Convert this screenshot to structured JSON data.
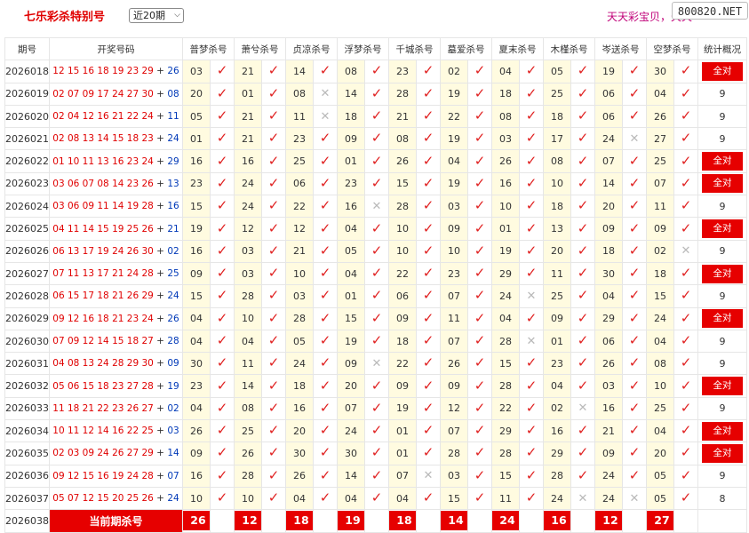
{
  "header": {
    "title": "七乐彩杀特别号",
    "period_select": "近20期",
    "slogan": "天天彩宝贝，天天",
    "watermark": "800820.NET"
  },
  "table": {
    "columns": [
      "期号",
      "开奖号码",
      "普梦杀号",
      "萧兮杀号",
      "贞凉杀号",
      "浮梦杀号",
      "千城杀号",
      "墓爱杀号",
      "夏末杀号",
      "木槿杀号",
      "岑送杀号",
      "空梦杀号",
      "统计概况"
    ],
    "rows": [
      {
        "issue": "2026018",
        "main": "12 15 16 18 19 23 29",
        "special": "26",
        "kills": [
          "03",
          "21",
          "14",
          "08",
          "23",
          "02",
          "04",
          "05",
          "19",
          "30"
        ],
        "marks": [
          "ok",
          "ok",
          "ok",
          "ok",
          "ok",
          "ok",
          "ok",
          "ok",
          "ok",
          "ok"
        ],
        "stat": "全对"
      },
      {
        "issue": "2026019",
        "main": "02 07 09 17 24 27 30",
        "special": "08",
        "kills": [
          "20",
          "01",
          "08",
          "14",
          "28",
          "19",
          "18",
          "25",
          "06",
          "04"
        ],
        "marks": [
          "ok",
          "ok",
          "ng",
          "ok",
          "ok",
          "ok",
          "ok",
          "ok",
          "ok",
          "ok"
        ],
        "stat": "9"
      },
      {
        "issue": "2026020",
        "main": "02 04 12 16 21 22 24",
        "special": "11",
        "kills": [
          "05",
          "21",
          "11",
          "18",
          "21",
          "22",
          "08",
          "18",
          "06",
          "26"
        ],
        "marks": [
          "ok",
          "ok",
          "ng",
          "ok",
          "ok",
          "ok",
          "ok",
          "ok",
          "ok",
          "ok"
        ],
        "stat": "9"
      },
      {
        "issue": "2026021",
        "main": "02 08 13 14 15 18 23",
        "special": "24",
        "kills": [
          "01",
          "21",
          "23",
          "09",
          "08",
          "19",
          "03",
          "17",
          "24",
          "27"
        ],
        "marks": [
          "ok",
          "ok",
          "ok",
          "ok",
          "ok",
          "ok",
          "ok",
          "ok",
          "ng",
          "ok"
        ],
        "stat": "9"
      },
      {
        "issue": "2026022",
        "main": "01 10 11 13 16 23 24",
        "special": "29",
        "kills": [
          "16",
          "16",
          "25",
          "01",
          "26",
          "04",
          "26",
          "08",
          "07",
          "25"
        ],
        "marks": [
          "ok",
          "ok",
          "ok",
          "ok",
          "ok",
          "ok",
          "ok",
          "ok",
          "ok",
          "ok"
        ],
        "stat": "全对"
      },
      {
        "issue": "2026023",
        "main": "03 06 07 08 14 23 26",
        "special": "13",
        "kills": [
          "23",
          "24",
          "06",
          "23",
          "15",
          "19",
          "16",
          "10",
          "14",
          "07"
        ],
        "marks": [
          "ok",
          "ok",
          "ok",
          "ok",
          "ok",
          "ok",
          "ok",
          "ok",
          "ok",
          "ok"
        ],
        "stat": "全对"
      },
      {
        "issue": "2026024",
        "main": "03 06 09 11 14 19 28",
        "special": "16",
        "kills": [
          "15",
          "24",
          "22",
          "16",
          "28",
          "03",
          "10",
          "18",
          "20",
          "11"
        ],
        "marks": [
          "ok",
          "ok",
          "ok",
          "ng",
          "ok",
          "ok",
          "ok",
          "ok",
          "ok",
          "ok"
        ],
        "stat": "9"
      },
      {
        "issue": "2026025",
        "main": "04 11 14 15 19 25 26",
        "special": "21",
        "kills": [
          "19",
          "12",
          "12",
          "04",
          "10",
          "09",
          "01",
          "13",
          "09",
          "09"
        ],
        "marks": [
          "ok",
          "ok",
          "ok",
          "ok",
          "ok",
          "ok",
          "ok",
          "ok",
          "ok",
          "ok"
        ],
        "stat": "全对"
      },
      {
        "issue": "2026026",
        "main": "06 13 17 19 24 26 30",
        "special": "02",
        "kills": [
          "16",
          "03",
          "21",
          "05",
          "10",
          "10",
          "19",
          "20",
          "18",
          "02"
        ],
        "marks": [
          "ok",
          "ok",
          "ok",
          "ok",
          "ok",
          "ok",
          "ok",
          "ok",
          "ok",
          "ng"
        ],
        "stat": "9"
      },
      {
        "issue": "2026027",
        "main": "07 11 13 17 21 24 28",
        "special": "25",
        "kills": [
          "09",
          "03",
          "10",
          "04",
          "22",
          "23",
          "29",
          "11",
          "30",
          "18"
        ],
        "marks": [
          "ok",
          "ok",
          "ok",
          "ok",
          "ok",
          "ok",
          "ok",
          "ok",
          "ok",
          "ok"
        ],
        "stat": "全对"
      },
      {
        "issue": "2026028",
        "main": "06 15 17 18 21 26 29",
        "special": "24",
        "kills": [
          "15",
          "28",
          "03",
          "01",
          "06",
          "07",
          "24",
          "25",
          "04",
          "15"
        ],
        "marks": [
          "ok",
          "ok",
          "ok",
          "ok",
          "ok",
          "ok",
          "ng",
          "ok",
          "ok",
          "ok"
        ],
        "stat": "9"
      },
      {
        "issue": "2026029",
        "main": "09 12 16 18 21 23 24",
        "special": "26",
        "kills": [
          "04",
          "10",
          "28",
          "15",
          "09",
          "11",
          "04",
          "09",
          "29",
          "24"
        ],
        "marks": [
          "ok",
          "ok",
          "ok",
          "ok",
          "ok",
          "ok",
          "ok",
          "ok",
          "ok",
          "ok"
        ],
        "stat": "全对"
      },
      {
        "issue": "2026030",
        "main": "07 09 12 14 15 18 27",
        "special": "28",
        "kills": [
          "04",
          "04",
          "05",
          "19",
          "18",
          "07",
          "28",
          "01",
          "06",
          "04"
        ],
        "marks": [
          "ok",
          "ok",
          "ok",
          "ok",
          "ok",
          "ok",
          "ng",
          "ok",
          "ok",
          "ok"
        ],
        "stat": "9"
      },
      {
        "issue": "2026031",
        "main": "04 08 13 24 28 29 30",
        "special": "09",
        "kills": [
          "30",
          "11",
          "24",
          "09",
          "22",
          "26",
          "15",
          "23",
          "26",
          "08"
        ],
        "marks": [
          "ok",
          "ok",
          "ok",
          "ng",
          "ok",
          "ok",
          "ok",
          "ok",
          "ok",
          "ok"
        ],
        "stat": "9"
      },
      {
        "issue": "2026032",
        "main": "05 06 15 18 23 27 28",
        "special": "19",
        "kills": [
          "23",
          "14",
          "18",
          "20",
          "09",
          "09",
          "28",
          "04",
          "03",
          "10"
        ],
        "marks": [
          "ok",
          "ok",
          "ok",
          "ok",
          "ok",
          "ok",
          "ok",
          "ok",
          "ok",
          "ok"
        ],
        "stat": "全对"
      },
      {
        "issue": "2026033",
        "main": "11 18 21 22 23 26 27",
        "special": "02",
        "kills": [
          "04",
          "08",
          "16",
          "07",
          "19",
          "12",
          "22",
          "02",
          "16",
          "25"
        ],
        "marks": [
          "ok",
          "ok",
          "ok",
          "ok",
          "ok",
          "ok",
          "ok",
          "ng",
          "ok",
          "ok"
        ],
        "stat": "9"
      },
      {
        "issue": "2026034",
        "main": "10 11 12 14 16 22 25",
        "special": "03",
        "kills": [
          "26",
          "25",
          "20",
          "24",
          "01",
          "07",
          "29",
          "16",
          "21",
          "04"
        ],
        "marks": [
          "ok",
          "ok",
          "ok",
          "ok",
          "ok",
          "ok",
          "ok",
          "ok",
          "ok",
          "ok"
        ],
        "stat": "全对"
      },
      {
        "issue": "2026035",
        "main": "02 03 09 24 26 27 29",
        "special": "14",
        "kills": [
          "09",
          "26",
          "30",
          "30",
          "01",
          "28",
          "28",
          "29",
          "09",
          "20"
        ],
        "marks": [
          "ok",
          "ok",
          "ok",
          "ok",
          "ok",
          "ok",
          "ok",
          "ok",
          "ok",
          "ok"
        ],
        "stat": "全对"
      },
      {
        "issue": "2026036",
        "main": "09 12 15 16 19 24 28",
        "special": "07",
        "kills": [
          "16",
          "28",
          "26",
          "14",
          "07",
          "03",
          "15",
          "28",
          "24",
          "05"
        ],
        "marks": [
          "ok",
          "ok",
          "ok",
          "ok",
          "ng",
          "ok",
          "ok",
          "ok",
          "ok",
          "ok"
        ],
        "stat": "9"
      },
      {
        "issue": "2026037",
        "main": "05 07 12 15 20 25 26",
        "special": "24",
        "kills": [
          "10",
          "10",
          "04",
          "04",
          "04",
          "15",
          "11",
          "24",
          "24",
          "05"
        ],
        "marks": [
          "ok",
          "ok",
          "ok",
          "ok",
          "ok",
          "ok",
          "ok",
          "ng",
          "ng",
          "ok"
        ],
        "stat": "8"
      }
    ],
    "current": {
      "issue": "2026038",
      "label": "当前期杀号",
      "predictions": [
        "26",
        "12",
        "18",
        "19",
        "18",
        "14",
        "24",
        "16",
        "12",
        "27"
      ]
    }
  },
  "colors": {
    "accent_red": "#e60000",
    "special_blue": "#0039b8",
    "kill_cell_bg": "#fffbe0",
    "slogan_magenta": "#c00078"
  },
  "icons": {
    "ok": "check-mark-icon",
    "ng": "cross-mark-icon"
  }
}
